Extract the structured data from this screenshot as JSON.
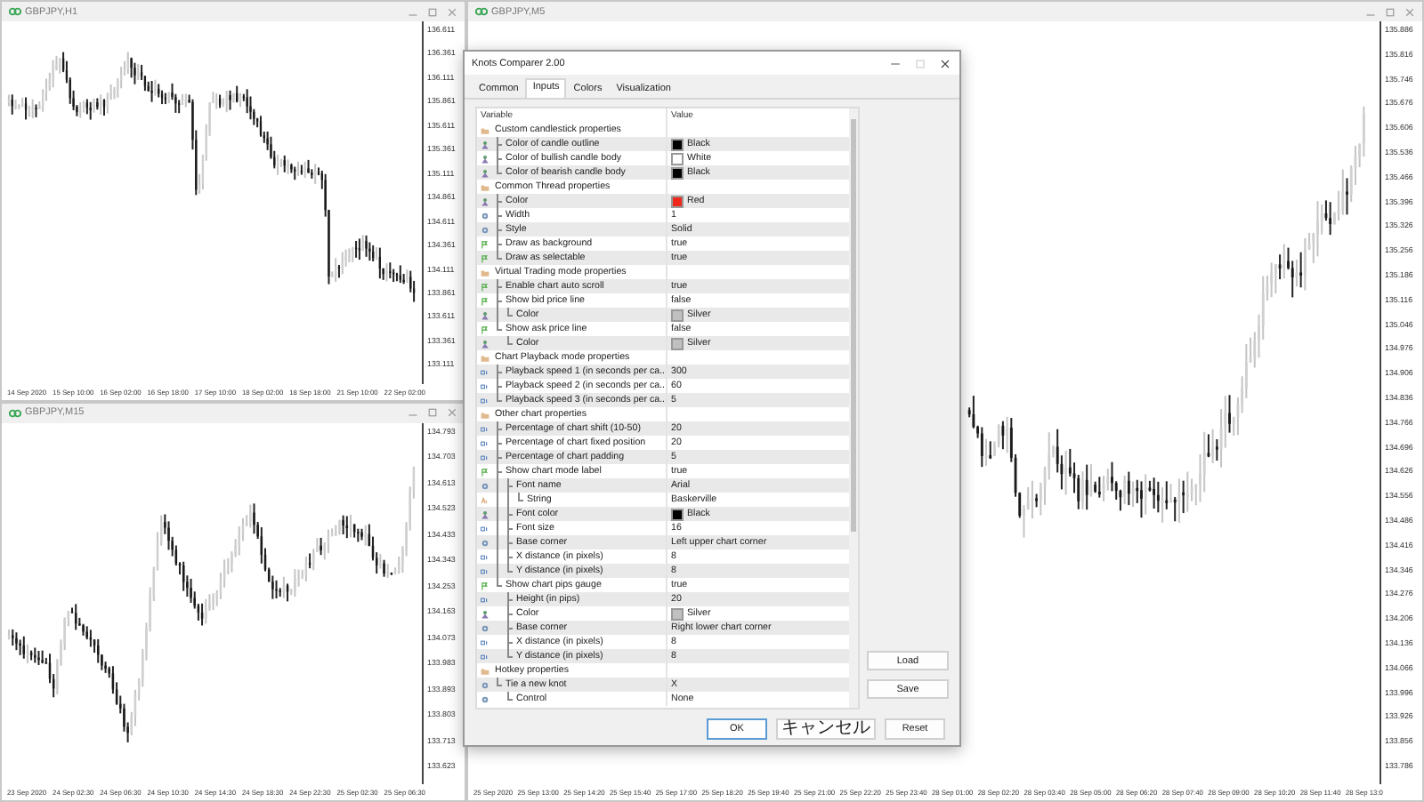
{
  "chart_windows": [
    {
      "title": "GBPJPY,H1",
      "price_labels": [
        "136.611",
        "136.361",
        "136.111",
        "135.861",
        "135.611",
        "135.361",
        "135.111",
        "134.861",
        "134.611",
        "134.361",
        "134.111",
        "133.861",
        "133.611",
        "133.361",
        "133.111"
      ],
      "time_labels": [
        "14 Sep 2020",
        "15 Sep 10:00",
        "16 Sep 02:00",
        "16 Sep 18:00",
        "17 Sep 10:00",
        "18 Sep 02:00",
        "18 Sep 18:00",
        "21 Sep 10:00",
        "22 Sep 02:00"
      ]
    },
    {
      "title": "GBPJPY,M15",
      "price_labels": [
        "134.793",
        "134.703",
        "134.613",
        "134.523",
        "134.433",
        "134.343",
        "134.253",
        "134.163",
        "134.073",
        "133.983",
        "133.893",
        "133.803",
        "133.713",
        "133.623"
      ],
      "time_labels": [
        "23 Sep 2020",
        "24 Sep 02:30",
        "24 Sep 06:30",
        "24 Sep 10:30",
        "24 Sep 14:30",
        "24 Sep 18:30",
        "24 Sep 22:30",
        "25 Sep 02:30",
        "25 Sep 06:30"
      ]
    },
    {
      "title": "GBPJPY,M5",
      "price_labels": [
        "135.886",
        "135.816",
        "135.746",
        "135.676",
        "135.606",
        "135.536",
        "135.466",
        "135.396",
        "135.326",
        "135.256",
        "135.186",
        "135.116",
        "135.046",
        "134.976",
        "134.906",
        "134.836",
        "134.766",
        "134.696",
        "134.626",
        "134.556",
        "134.486",
        "134.416",
        "134.346",
        "134.276",
        "134.206",
        "134.136",
        "134.066",
        "133.996",
        "133.926",
        "133.856",
        "133.786"
      ],
      "time_labels": [
        "25 Sep 2020",
        "25 Sep 13:00",
        "25 Sep 14:20",
        "25 Sep 15:40",
        "25 Sep 17:00",
        "25 Sep 18:20",
        "25 Sep 19:40",
        "25 Sep 21:00",
        "25 Sep 22:20",
        "25 Sep 23:40",
        "28 Sep 01:00",
        "28 Sep 02:20",
        "28 Sep 03:40",
        "28 Sep 05:00",
        "28 Sep 06:20",
        "28 Sep 07:40",
        "28 Sep 09:00",
        "28 Sep 10:20",
        "28 Sep 11:40",
        "28 Sep 13:0"
      ]
    }
  ],
  "dialog": {
    "title": "Knots Comparer 2.00",
    "tabs": [
      {
        "label": "Common",
        "selected": false
      },
      {
        "label": "Inputs",
        "selected": true
      },
      {
        "label": "Colors",
        "selected": false
      },
      {
        "label": "Visualization",
        "selected": false
      }
    ],
    "columns": [
      "Variable",
      "Value"
    ],
    "properties": [
      {
        "kind": "group",
        "label": "Custom candlestick properties",
        "children": [
          {
            "kind": "color",
            "label": "Color of candle outline",
            "value": "Black",
            "color": "#000000"
          },
          {
            "kind": "color",
            "label": "Color of bullish candle body",
            "value": "White",
            "color": "#ffffff"
          },
          {
            "kind": "color",
            "label": "Color of bearish candle body",
            "value": "Black",
            "color": "#000000"
          }
        ]
      },
      {
        "kind": "group",
        "label": "Common Thread properties",
        "children": [
          {
            "kind": "color",
            "label": "Color",
            "value": "Red",
            "color": "#f0281c"
          },
          {
            "kind": "enum",
            "label": "Width",
            "value": "1"
          },
          {
            "kind": "enum",
            "label": "Style",
            "value": "Solid"
          },
          {
            "kind": "bool",
            "label": "Draw as background",
            "value": "true"
          },
          {
            "kind": "bool",
            "label": "Draw as selectable",
            "value": "true"
          }
        ]
      },
      {
        "kind": "group",
        "label": "Virtual Trading mode properties",
        "children": [
          {
            "kind": "bool",
            "label": "Enable chart auto scroll",
            "value": "true"
          },
          {
            "kind": "bool",
            "label": "Show bid price line",
            "value": "false",
            "children": [
              {
                "kind": "color",
                "label": "Color",
                "value": "Silver",
                "color": "#c0c0c0"
              }
            ]
          },
          {
            "kind": "bool",
            "label": "Show ask price line",
            "value": "false",
            "children": [
              {
                "kind": "color",
                "label": "Color",
                "value": "Silver",
                "color": "#c0c0c0"
              }
            ]
          }
        ]
      },
      {
        "kind": "group",
        "label": "Chart Playback mode properties",
        "children": [
          {
            "kind": "number",
            "label": "Playback speed 1 (in seconds per ca...",
            "value": "300"
          },
          {
            "kind": "number",
            "label": "Playback speed 2 (in seconds per ca...",
            "value": "60"
          },
          {
            "kind": "number",
            "label": "Playback speed 3 (in seconds per ca...",
            "value": "5"
          }
        ]
      },
      {
        "kind": "group",
        "label": "Other chart properties",
        "children": [
          {
            "kind": "number",
            "label": "Percentage of chart shift (10-50)",
            "value": "20"
          },
          {
            "kind": "number",
            "label": "Percentage of chart fixed position",
            "value": "20"
          },
          {
            "kind": "number",
            "label": "Percentage of chart padding",
            "value": "5"
          },
          {
            "kind": "bool",
            "label": "Show chart mode label",
            "value": "true",
            "children": [
              {
                "kind": "enum",
                "label": "Font name",
                "value": "Arial",
                "children": [
                  {
                    "kind": "string",
                    "label": "String",
                    "value": "Baskerville"
                  }
                ]
              },
              {
                "kind": "color",
                "label": "Font color",
                "value": "Black",
                "color": "#000000"
              },
              {
                "kind": "number",
                "label": "Font size",
                "value": "16"
              },
              {
                "kind": "enum",
                "label": "Base corner",
                "value": "Left upper chart corner"
              },
              {
                "kind": "number",
                "label": "X distance (in pixels)",
                "value": "8"
              },
              {
                "kind": "number",
                "label": "Y distance (in pixels)",
                "value": "8"
              }
            ]
          },
          {
            "kind": "bool",
            "label": "Show chart pips gauge",
            "value": "true",
            "children": [
              {
                "kind": "number",
                "label": "Height (in pips)",
                "value": "20"
              },
              {
                "kind": "color",
                "label": "Color",
                "value": "Silver",
                "color": "#c0c0c0"
              },
              {
                "kind": "enum",
                "label": "Base corner",
                "value": "Right lower chart corner"
              },
              {
                "kind": "number",
                "label": "X distance (in pixels)",
                "value": "8"
              },
              {
                "kind": "number",
                "label": "Y distance (in pixels)",
                "value": "8"
              }
            ]
          }
        ]
      },
      {
        "kind": "group",
        "label": "Hotkey properties",
        "children": [
          {
            "kind": "enum",
            "label": "Tie a new knot",
            "value": "X",
            "children": [
              {
                "kind": "enum",
                "label": "Control",
                "value": "None"
              }
            ]
          }
        ]
      }
    ],
    "side_buttons": [
      "Load",
      "Save"
    ],
    "buttons": [
      "OK",
      "キャンセル",
      "Reset"
    ]
  }
}
